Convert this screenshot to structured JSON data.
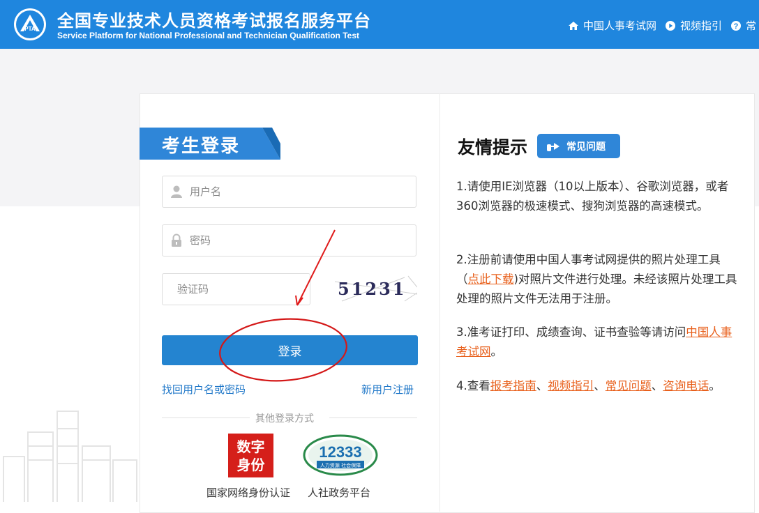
{
  "header": {
    "title": "全国专业技术人员资格考试报名服务平台",
    "subtitle": "Service Platform for National Professional and Technician Qualification Test",
    "logo_text": "PTA",
    "nav": [
      {
        "label": "中国人事考试网",
        "icon": "home-icon"
      },
      {
        "label": "视频指引",
        "icon": "play-icon"
      },
      {
        "label": "常",
        "icon": "help-icon"
      }
    ]
  },
  "login": {
    "heading": "考生登录",
    "username_placeholder": "用户名",
    "password_placeholder": "密码",
    "captcha_placeholder": "验证码",
    "captcha_text": "51231",
    "submit_label": "登录",
    "forgot_link": "找回用户名或密码",
    "register_link": "新用户注册",
    "other_methods": "其他登录方式",
    "alt_methods": [
      {
        "label": "国家网络身份认证",
        "logo_line1": "数字",
        "logo_line2": "身份"
      },
      {
        "label": "人社政务平台",
        "logo_number": "12333",
        "logo_caption": "人力资源 社会保障"
      }
    ]
  },
  "tips": {
    "title": "友情提示",
    "faq_badge": "常见问题",
    "t1": "1.请使用IE浏览器（10以上版本）、谷歌浏览器，或者360浏览器的极速模式、搜狗浏览器的高速模式。",
    "t2_a": "2.注册前请使用中国人事考试网提供的照片处理工具（",
    "t2_link": "点此下载",
    "t2_b": ")对照片文件进行处理。未经该照片处理工具处理的照片文件无法用于注册。",
    "t3_a": "3.准考证打印、成绩查询、证书查验等请访问",
    "t3_link": "中国人事考试网",
    "t3_b": "。",
    "t4_a": "4.查看",
    "t4_l1": "报考指南",
    "t4_s1": "、",
    "t4_l2": "视频指引",
    "t4_s2": "、",
    "t4_l3": "常见问题",
    "t4_s3": "、",
    "t4_l4": "咨询电话",
    "t4_b": "。"
  },
  "colors": {
    "header_bg": "#1f86de",
    "primary": "#2484d0",
    "link": "#1f77c8",
    "highlight": "#e8601c",
    "annotation": "#e01b1b"
  }
}
